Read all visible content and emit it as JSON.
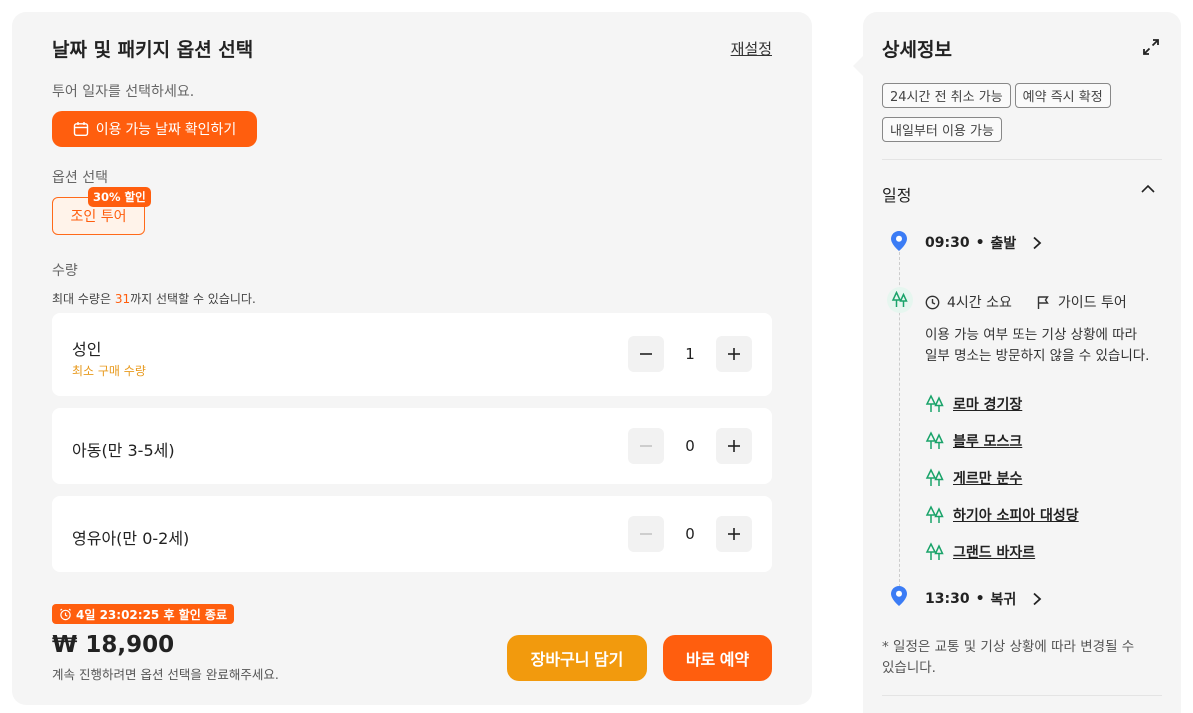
{
  "booking": {
    "title": "날짜 및 패키지 옵션 선택",
    "reset_label": "재설정",
    "date_prompt": "투어 일자를 선택하세요.",
    "date_button_label": "이용 가능 날짜 확인하기",
    "option_label": "옵션 선택",
    "option": {
      "label": "조인 투어",
      "badge": "30% 할인"
    },
    "quantity_label": "수량",
    "quantity_note_prefix": "최대 수량은 ",
    "quantity_note_max": "31",
    "quantity_note_suffix": "까지 선택할 수 있습니다.",
    "rows": [
      {
        "name": "성인",
        "note": "최소 구매 수량",
        "value": "1"
      },
      {
        "name": "아동(만 3-5세)",
        "value": "0"
      },
      {
        "name": "영유아(만 0-2세)",
        "value": "0"
      }
    ],
    "timer_label": "4일 23:02:25 후 할인 종료",
    "price": "₩ 18,900",
    "price_note": "계속 진행하려면 옵션 선택을 완료해주세요.",
    "cart_label": "장바구니 담기",
    "book_label": "바로 예약"
  },
  "details": {
    "title": "상세정보",
    "tags": [
      "24시간 전 취소 가능",
      "예약 즉시 확정",
      "내일부터 이용 가능"
    ],
    "schedule_title": "일정",
    "start": {
      "time": "09:30",
      "sep": "•",
      "label": "출발"
    },
    "duration": "4시간 소요",
    "guide": "가이드 투어",
    "description": "이용 가능 여부 또는 기상 상황에 따라 일부 명소는 방문하지 않을 수 있습니다.",
    "places": [
      "로마 경기장",
      "블루 모스크",
      "게르만 분수",
      "하기아 소피아 대성당",
      "그랜드 바자르"
    ],
    "end": {
      "time": "13:30",
      "sep": "•",
      "label": "복귀"
    },
    "footnote": "* 일정은 교통 및 기상 상황에 따라 변경될 수 있습니다."
  },
  "colors": {
    "accent": "#ff5e0e",
    "cart": "#f29a0d",
    "pin": "#3b7cf5",
    "spot": "#1aa36a"
  },
  "icons": {
    "date_button": "calendar-icon",
    "timer": "alarm-clock-icon",
    "expand": "expand-icon",
    "collapse": "chevron-up-icon",
    "pin": "location-pin-icon",
    "spot": "trees-icon",
    "duration": "clock-icon",
    "guide": "flag-icon",
    "place": "trees-icon",
    "stop_arrow": "chevron-right-icon",
    "minus": "minus-icon",
    "plus": "plus-icon"
  }
}
